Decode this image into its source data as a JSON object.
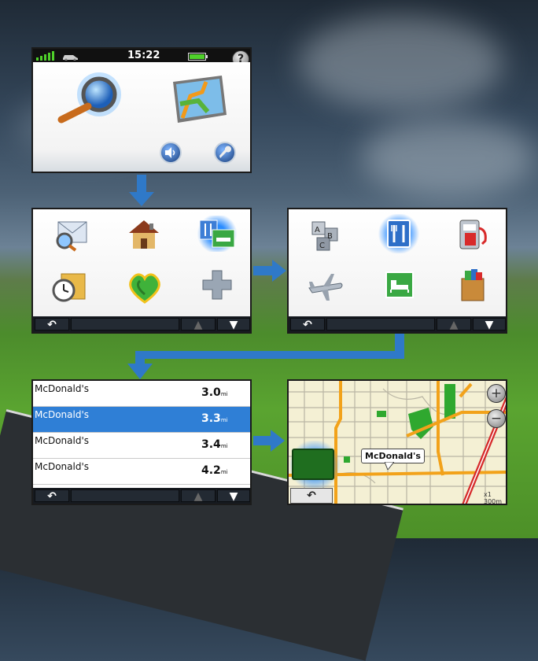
{
  "status": {
    "time": "15:22",
    "help_label": "?"
  },
  "main_menu": {
    "where_to": "search-icon",
    "view_map": "map-icon",
    "volume": "speaker-icon",
    "tools": "wrench-icon"
  },
  "category_menu": {
    "icons": [
      "address-icon",
      "home-icon",
      "poi-icon",
      "recent-icon",
      "favorites-icon",
      "extras-icon"
    ]
  },
  "poi_menu": {
    "icons": [
      "abc-icon",
      "food-icon",
      "fuel-icon",
      "transit-icon",
      "lodging-icon",
      "shopping-icon"
    ]
  },
  "results": [
    {
      "name": "McDonald's",
      "distance": "3.0",
      "unit": "mi",
      "selected": false
    },
    {
      "name": "McDonald's",
      "distance": "3.3",
      "unit": "mi",
      "selected": true
    },
    {
      "name": "McDonald's",
      "distance": "3.4",
      "unit": "mi",
      "selected": false
    },
    {
      "name": "McDonald's",
      "distance": "4.2",
      "unit": "mi",
      "selected": false
    }
  ],
  "map": {
    "callout": "McDonald's",
    "zoom_in": "+",
    "zoom_out": "−",
    "scale": "300m",
    "scale_prefix": "x1"
  },
  "buttons": {
    "back": "↶",
    "up": "▲",
    "down": "▼"
  },
  "colors": {
    "accent": "#2f79c8",
    "selected_row": "#2f7fd6",
    "route": "#f2a21a",
    "highway": "#d62a2a",
    "park": "#2fa82f"
  }
}
